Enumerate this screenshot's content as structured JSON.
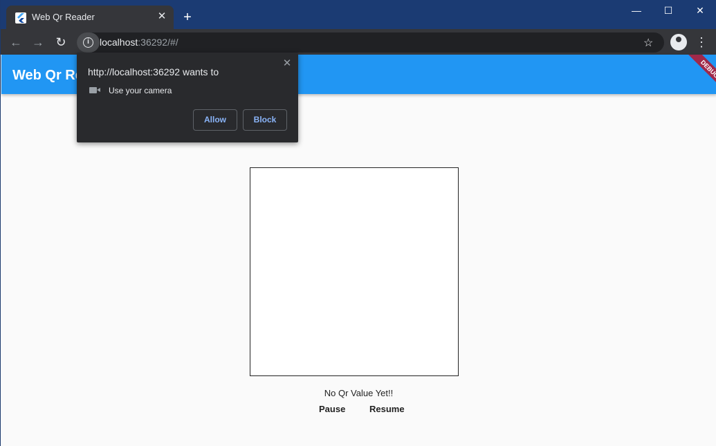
{
  "browser": {
    "tab_title": "Web Qr Reader",
    "tab_close": "✕",
    "new_tab": "+",
    "window_controls": {
      "minimize": "—",
      "maximize": "☐",
      "close": "✕"
    },
    "nav": {
      "back": "←",
      "forward": "→",
      "reload": "↻"
    },
    "url_host": "localhost",
    "url_rest": ":36292/#/",
    "info_icon": "i",
    "star": "☆",
    "menu": "⋮"
  },
  "app": {
    "title": "Web Qr Reader",
    "debug_banner": "DEBUG",
    "accent_color": "#2196f3",
    "status_text": "No Qr Value Yet!!",
    "pause_label": "Pause",
    "resume_label": "Resume"
  },
  "permission_popup": {
    "title": "http://localhost:36292 wants to",
    "permission": "Use your camera",
    "close": "✕",
    "allow_label": "Allow",
    "block_label": "Block"
  }
}
